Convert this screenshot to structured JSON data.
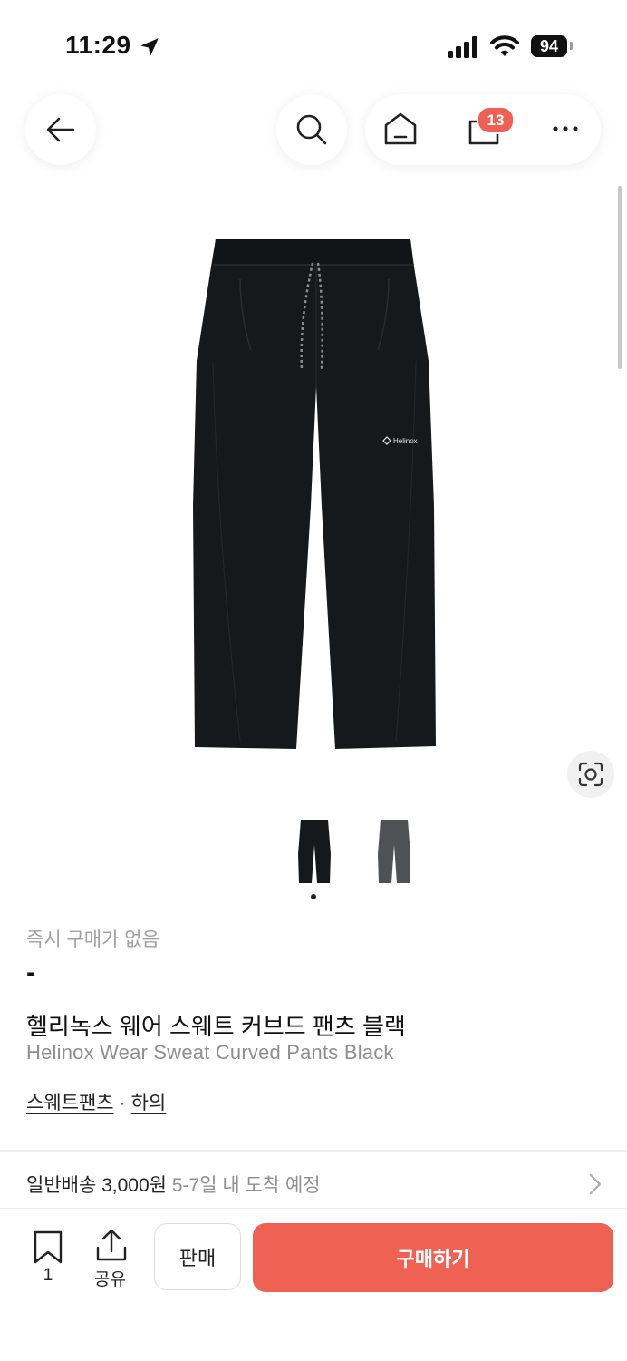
{
  "status_bar": {
    "time": "11:29",
    "battery": "94"
  },
  "header": {
    "cart_badge": "13"
  },
  "product": {
    "instant_buy_label": "즉시 구매가 없음",
    "price": "-",
    "name_ko": "헬리녹스 웨어 스웨트 커브드 팬츠 블랙",
    "name_en": "Helinox Wear Sweat Curved Pants Black",
    "brand_mark": "Helinox",
    "categories": [
      "스웨트팬츠",
      "하의"
    ],
    "category_separator": "·",
    "colors": {
      "black": "#16191b",
      "charcoal": "#4f5154"
    }
  },
  "shipping": {
    "method": "일반배송 3,000원",
    "eta": "5-7일 내 도착 예정"
  },
  "bottom_bar": {
    "save_count": "1",
    "share_label": "공유",
    "sell_label": "판매",
    "buy_label": "구매하기",
    "accent_color": "#ef6253"
  }
}
